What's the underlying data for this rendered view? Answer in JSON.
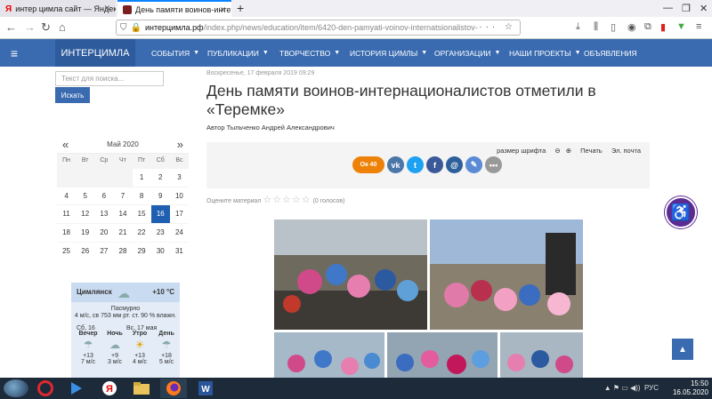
{
  "browser": {
    "tabs": [
      {
        "title": "интер цимла сайт — Яндекс: на"
      },
      {
        "title": "День памяти воинов-интерна"
      }
    ],
    "url_domain": "интерцимла.рф",
    "url_path": "/index.php/news/education/item/6420-den-pamyati-voinov-internatsionalistov-",
    "nav_icons": [
      "back-icon",
      "forward-icon",
      "reload-icon",
      "home-icon"
    ]
  },
  "site": {
    "brand": "ИНТЕРЦИМЛА",
    "menu": [
      {
        "label": "СОБЫТИЯ",
        "caret": true
      },
      {
        "label": "ПУБЛИКАЦИИ",
        "caret": true
      },
      {
        "label": "ТВОРЧЕСТВО",
        "caret": true
      },
      {
        "label": "ИСТОРИЯ ЦИМЛЫ",
        "caret": true
      },
      {
        "label": "ОРГАНИЗАЦИИ",
        "caret": true
      },
      {
        "label": "НАШИ ПРОЕКТЫ",
        "caret": true
      },
      {
        "label": "ОБЪЯВЛЕНИЯ",
        "caret": false
      }
    ]
  },
  "search": {
    "placeholder": "Текст для поиска...",
    "button": "Искать"
  },
  "calendar": {
    "prev": "«",
    "next": "»",
    "title": "Май 2020",
    "dow": [
      "Пн",
      "Вт",
      "Ср",
      "Чт",
      "Пт",
      "Сб",
      "Вс"
    ],
    "days": [
      "",
      "",
      "",
      "",
      "1",
      "2",
      "3",
      "4",
      "5",
      "6",
      "7",
      "8",
      "9",
      "10",
      "11",
      "12",
      "13",
      "14",
      "15",
      "16",
      "17",
      "18",
      "19",
      "20",
      "21",
      "22",
      "23",
      "24",
      "25",
      "26",
      "27",
      "28",
      "29",
      "30",
      "31"
    ],
    "selected": "16"
  },
  "weather": {
    "city": "Цимлянск",
    "temp": "+10 °C",
    "desc": "Пасмурно",
    "line": "4 м/с, св  753 мм рт. ст.  90 % влажн.",
    "day1": "Сб, 16",
    "day2": "Вс, 17 мая",
    "cols": [
      {
        "label": "Вечер",
        "icon": "rain-cloud-icon",
        "temp": "+13",
        "wind": "7 м/с"
      },
      {
        "label": "Ночь",
        "icon": "cloud-icon",
        "temp": "+9",
        "wind": "3 м/с"
      },
      {
        "label": "Утро",
        "icon": "sun-icon",
        "temp": "+13",
        "wind": "4 м/с"
      },
      {
        "label": "День",
        "icon": "rain-cloud-icon",
        "temp": "+18",
        "wind": "5 м/с"
      }
    ]
  },
  "article": {
    "date": "Воскресенье, 17 февраля 2019 09:29",
    "title": "День памяти воинов-интернационалистов отметили в «Теремке»",
    "author_label": "Автор",
    "author": "Тыльченко Андрей Александрович",
    "font_size_label": "размер шрифта",
    "print": "Печать",
    "email": "Эл. почта",
    "ok_count": "40",
    "rating_label": "Оцените материал",
    "votes": "(0 голосов)"
  },
  "taskbar": {
    "lang": "РУС",
    "time": "15:50",
    "date": "16.05.2020"
  },
  "colors": {
    "nav": "#3a6bb0",
    "brand": "#2e5b9c",
    "selected_day": "#1f5fb1",
    "accessibility": "#5c2b92"
  }
}
